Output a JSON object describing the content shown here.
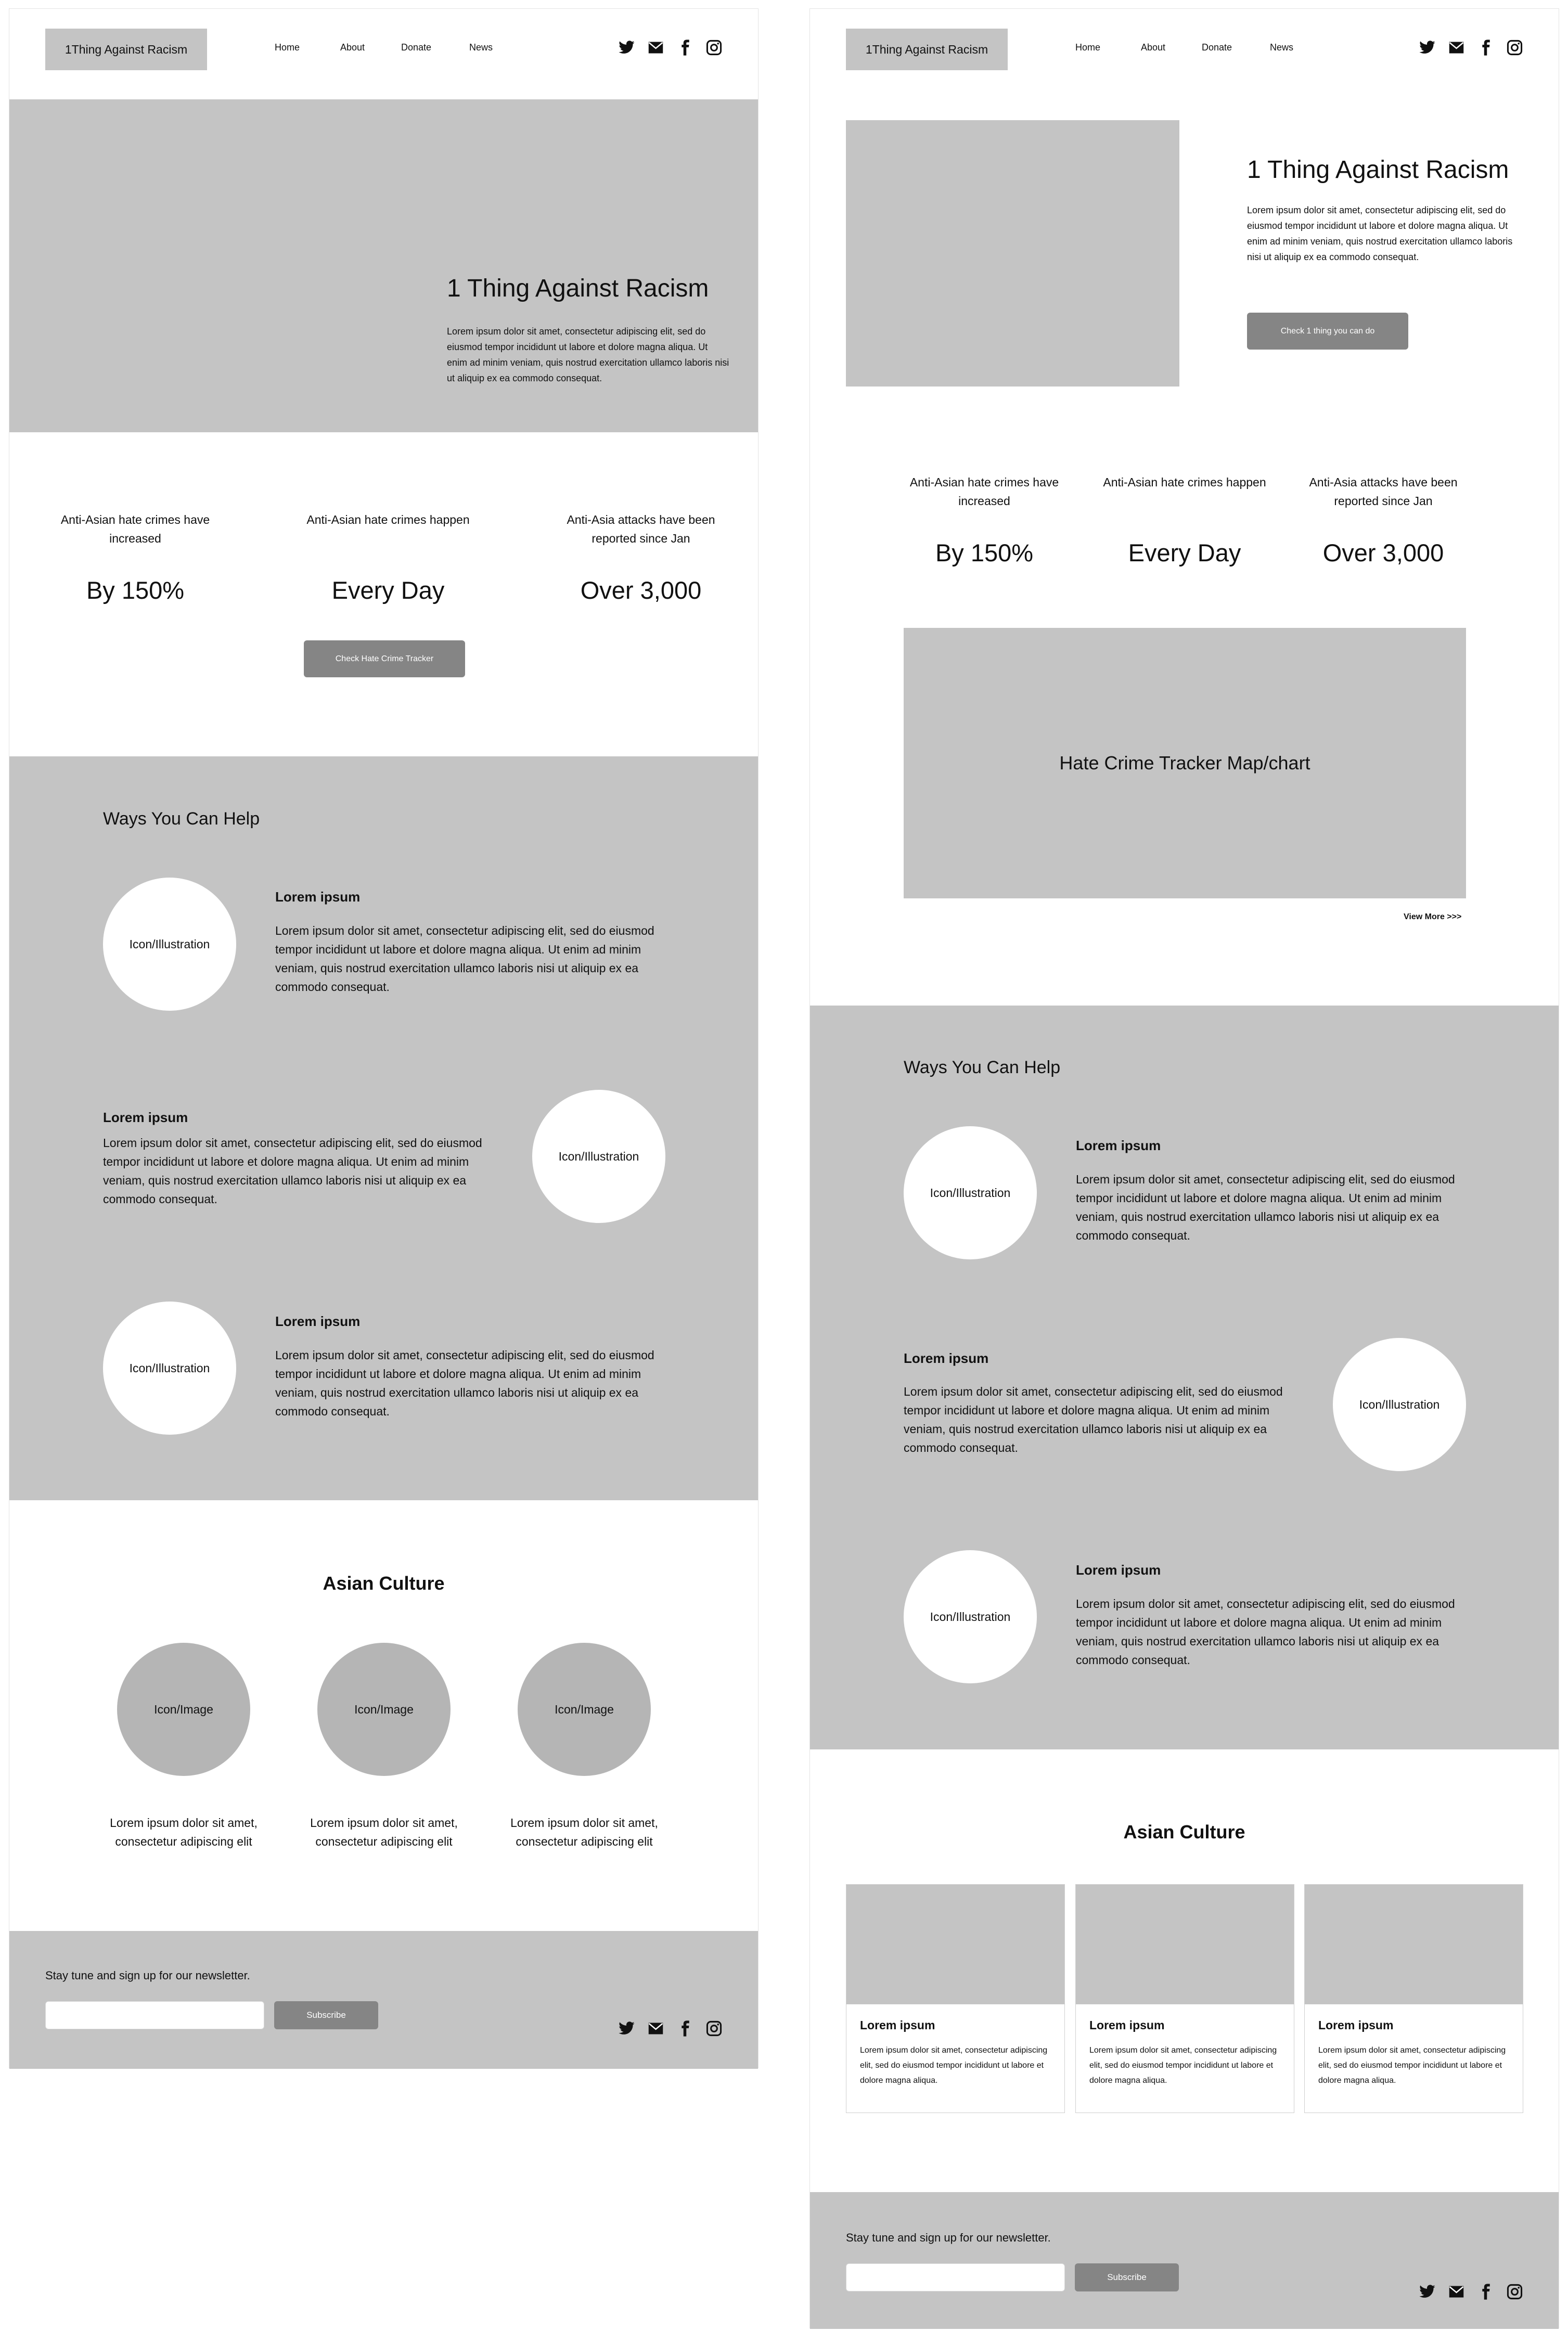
{
  "header": {
    "logo": "1Thing Against Racism",
    "nav": [
      "Home",
      "About",
      "Donate",
      "News"
    ],
    "social_icons": [
      "twitter-icon",
      "mail-icon",
      "facebook-icon",
      "instagram-icon"
    ]
  },
  "hero": {
    "title": "1 Thing Against Racism",
    "body": "Lorem ipsum dolor sit amet, consectetur adipiscing elit, sed do eiusmod tempor incididunt ut labore et dolore magna aliqua. Ut enim ad minim veniam, quis nostrud exercitation ullamco laboris nisi ut aliquip ex ea commodo consequat.",
    "cta": "Check 1 thing you can do"
  },
  "stats": [
    {
      "label": "Anti-Asian hate crimes have increased",
      "value": "By 150%"
    },
    {
      "label": "Anti-Asian hate crimes happen",
      "value": "Every Day"
    },
    {
      "label": "Anti-Asia attacks have been reported since Jan",
      "value": "Over 3,000"
    }
  ],
  "tracker": {
    "button": "Check Hate Crime Tracker",
    "map_label": "Hate Crime Tracker Map/chart",
    "view_more": "View More >>>"
  },
  "help": {
    "title": "Ways You Can Help",
    "circle_label": "Icon/Illustration",
    "items": [
      {
        "heading": "Lorem ipsum",
        "body": "Lorem ipsum dolor sit amet, consectetur adipiscing elit, sed do eiusmod tempor incididunt ut labore et dolore magna aliqua. Ut enim ad minim veniam, quis nostrud exercitation ullamco laboris nisi ut aliquip ex ea commodo consequat."
      },
      {
        "heading": "Lorem ipsum",
        "body": "Lorem ipsum dolor sit amet, consectetur adipiscing elit, sed do eiusmod tempor incididunt ut labore et dolore magna aliqua. Ut enim ad minim veniam, quis nostrud exercitation ullamco laboris nisi ut aliquip ex ea commodo consequat."
      },
      {
        "heading": "Lorem ipsum",
        "body": "Lorem ipsum dolor sit amet, consectetur adipiscing elit, sed do eiusmod tempor incididunt ut labore et dolore magna aliqua. Ut enim ad minim veniam, quis nostrud exercitation ullamco laboris nisi ut aliquip ex ea commodo consequat."
      }
    ]
  },
  "culture": {
    "title": "Asian Culture",
    "image_label": "Icon/Image",
    "captions": [
      "Lorem ipsum dolor sit amet, consectetur adipiscing elit",
      "Lorem ipsum dolor sit amet, consectetur adipiscing elit",
      "Lorem ipsum dolor sit amet, consectetur adipiscing elit"
    ],
    "cards": [
      {
        "title": "Lorem ipsum",
        "body": "Lorem ipsum dolor sit amet, consectetur adipiscing elit, sed do eiusmod tempor incididunt ut labore et dolore magna aliqua."
      },
      {
        "title": "Lorem ipsum",
        "body": "Lorem ipsum dolor sit amet, consectetur adipiscing elit, sed do eiusmod tempor incididunt ut labore et dolore magna aliqua."
      },
      {
        "title": "Lorem ipsum",
        "body": "Lorem ipsum dolor sit amet, consectetur adipiscing elit, sed do eiusmod tempor incididunt ut labore et dolore magna aliqua."
      }
    ]
  },
  "footer": {
    "newsletter_text": "Stay tune and sign up for our newsletter.",
    "email_placeholder": "",
    "subscribe": "Subscribe"
  }
}
